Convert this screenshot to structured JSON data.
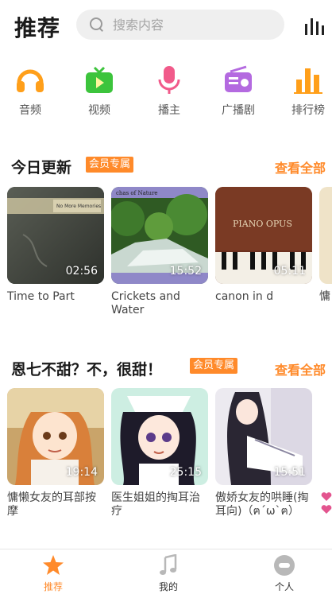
{
  "header": {
    "title": "推荐",
    "search_placeholder": "搜索内容"
  },
  "categories": [
    {
      "label": "音频",
      "icon": "headphones-icon",
      "color": "#ff9f1a"
    },
    {
      "label": "视频",
      "icon": "tv-icon",
      "color": "#3cc43c"
    },
    {
      "label": "播主",
      "icon": "microphone-icon",
      "color": "#f15a8a"
    },
    {
      "label": "广播剧",
      "icon": "radio-icon",
      "color": "#b46ae0"
    },
    {
      "label": "排行榜",
      "icon": "bar-chart-icon",
      "color": "#ff9f1a"
    }
  ],
  "sections": [
    {
      "title": "今日更新",
      "badge": "会员专属",
      "see_all": "查看全部",
      "items": [
        {
          "title": "Time to Part",
          "duration": "02:56"
        },
        {
          "title": "Crickets and Water",
          "duration": "15:52"
        },
        {
          "title": "canon in d",
          "duration": "05:11"
        },
        {
          "title": "慵"
        }
      ]
    },
    {
      "title": "恩七不甜？不，很甜！",
      "badge": "会员专属",
      "see_all": "查看全部",
      "items": [
        {
          "title": "慵懒女友的耳部按摩",
          "duration": "19:14"
        },
        {
          "title": "医生姐姐的掏耳治疗",
          "duration": "25:15"
        },
        {
          "title": "傲娇女友的哄睡(掏耳向)（ฅ´ω`ฅ）",
          "duration": "15:51"
        }
      ]
    }
  ],
  "thumb_texts": {
    "cricket_header": "chas of Nature",
    "piano_opus": "PIANO OPUS",
    "time_to_part_label": "No More Memories"
  },
  "bottom_tabs": [
    {
      "label": "推荐",
      "icon": "star-icon",
      "active": true
    },
    {
      "label": "我的",
      "icon": "music-note-icon",
      "active": false
    },
    {
      "label": "个人",
      "icon": "profile-icon",
      "active": false
    }
  ],
  "colors": {
    "accent": "#ff8a2a",
    "search_bg": "#efefef"
  }
}
